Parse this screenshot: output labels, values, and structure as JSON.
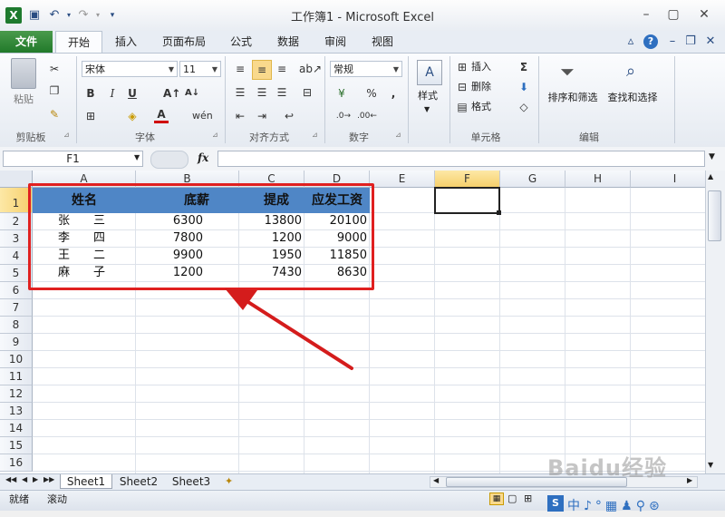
{
  "window": {
    "title": "工作簿1 - Microsoft Excel"
  },
  "tabs": [
    "文件",
    "开始",
    "插入",
    "页面布局",
    "公式",
    "数据",
    "审阅",
    "视图"
  ],
  "ribbon": {
    "clipboard": {
      "paste": "粘贴",
      "label": "剪贴板"
    },
    "font": {
      "name": "宋体",
      "size": "11",
      "bold": "B",
      "italic": "I",
      "underline": "U",
      "label": "字体"
    },
    "alignment": {
      "label": "对齐方式"
    },
    "number": {
      "format": "常规",
      "label": "数字"
    },
    "styles": {
      "button": "样式"
    },
    "cells": {
      "insert": "插入",
      "delete": "删除",
      "format": "格式",
      "label": "单元格"
    },
    "editing": {
      "sort": "排序和筛选",
      "find": "查找和选择",
      "label": "编辑"
    }
  },
  "formula_bar": {
    "name_box": "F1",
    "fx": "fx",
    "value": ""
  },
  "columns": [
    "A",
    "B",
    "C",
    "D",
    "E",
    "F",
    "G",
    "H",
    "I"
  ],
  "rows": [
    "1",
    "2",
    "3",
    "4",
    "5",
    "6",
    "7",
    "8",
    "9",
    "10",
    "11",
    "12",
    "13",
    "14",
    "15",
    "16"
  ],
  "table": {
    "headers": [
      "姓名",
      "底薪",
      "提成",
      "应发工资"
    ],
    "data": [
      [
        "张　　三",
        "6300",
        "13800",
        "20100"
      ],
      [
        "李　　四",
        "7800",
        "1200",
        "9000"
      ],
      [
        "王　　二",
        "9900",
        "1950",
        "11850"
      ],
      [
        "麻　　子",
        "1200",
        "7430",
        "8630"
      ]
    ]
  },
  "sheets": [
    "Sheet1",
    "Sheet2",
    "Sheet3"
  ],
  "status": {
    "ready": "就绪",
    "scroll": "滚动"
  },
  "watermark": "Baidu经验",
  "colors": {
    "header_fill": "#4f86c6",
    "highlight_border": "#e02020",
    "file_tab": "#217a2a"
  }
}
